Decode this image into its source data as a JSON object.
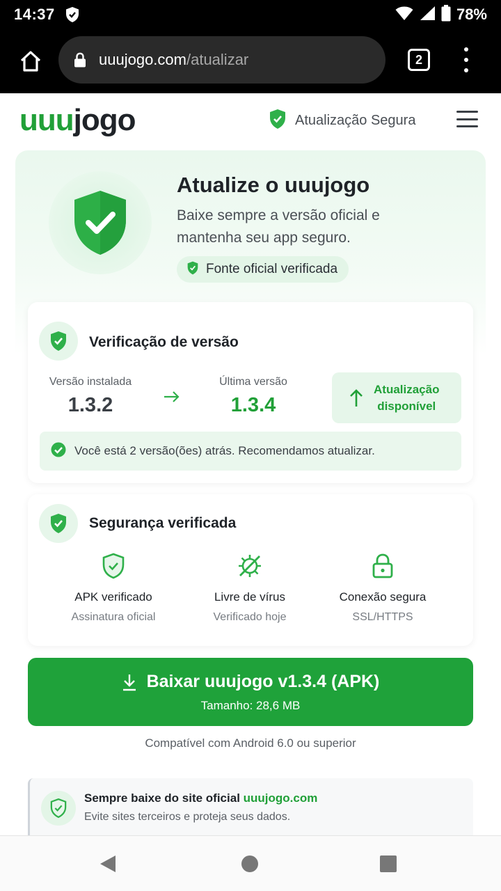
{
  "status_bar": {
    "time": "14:37",
    "battery": "78%"
  },
  "browser": {
    "url_host": "uuujogo.com",
    "url_path": "/atualizar",
    "tab_count": "2"
  },
  "header": {
    "logo_part1": "uuu",
    "logo_part2": "jogo",
    "secure_label": "Atualização Segura"
  },
  "hero": {
    "title": "Atualize o uuujogo",
    "subtitle": "Baixe sempre a versão oficial e mantenha seu app seguro.",
    "badge": "Fonte oficial verificada"
  },
  "version_card": {
    "title": "Verificação de versão",
    "installed_label": "Versão instalada",
    "installed_version": "1.3.2",
    "latest_label": "Última versão",
    "latest_version": "1.3.4",
    "update_line1": "Atualização",
    "update_line2": "disponível",
    "notice": "Você está 2 versão(ões) atrás. Recomendamos atualizar."
  },
  "security_card": {
    "title": "Segurança verificada",
    "features": [
      {
        "name": "APK verificado",
        "sub": "Assinatura oficial",
        "icon": "shield-check-icon"
      },
      {
        "name": "Livre de vírus",
        "sub": "Verificado hoje",
        "icon": "virus-blocked-icon"
      },
      {
        "name": "Conexão segura",
        "sub": "SSL/HTTPS",
        "icon": "lock-icon"
      }
    ]
  },
  "download": {
    "label": "Baixar uuujogo v1.3.4 (APK)",
    "size": "Tamanho: 28,6 MB",
    "compat": "Compatível com Android 6.0 ou superior"
  },
  "info": {
    "title": "Sempre baixe do site oficial",
    "link": "uuujogo.com",
    "sub": "Evite sites terceiros e proteja seus dados."
  },
  "colors": {
    "accent": "#1fa23a",
    "text": "#1f2328",
    "muted": "#5a5f65",
    "light_green": "#e6f6ea"
  }
}
